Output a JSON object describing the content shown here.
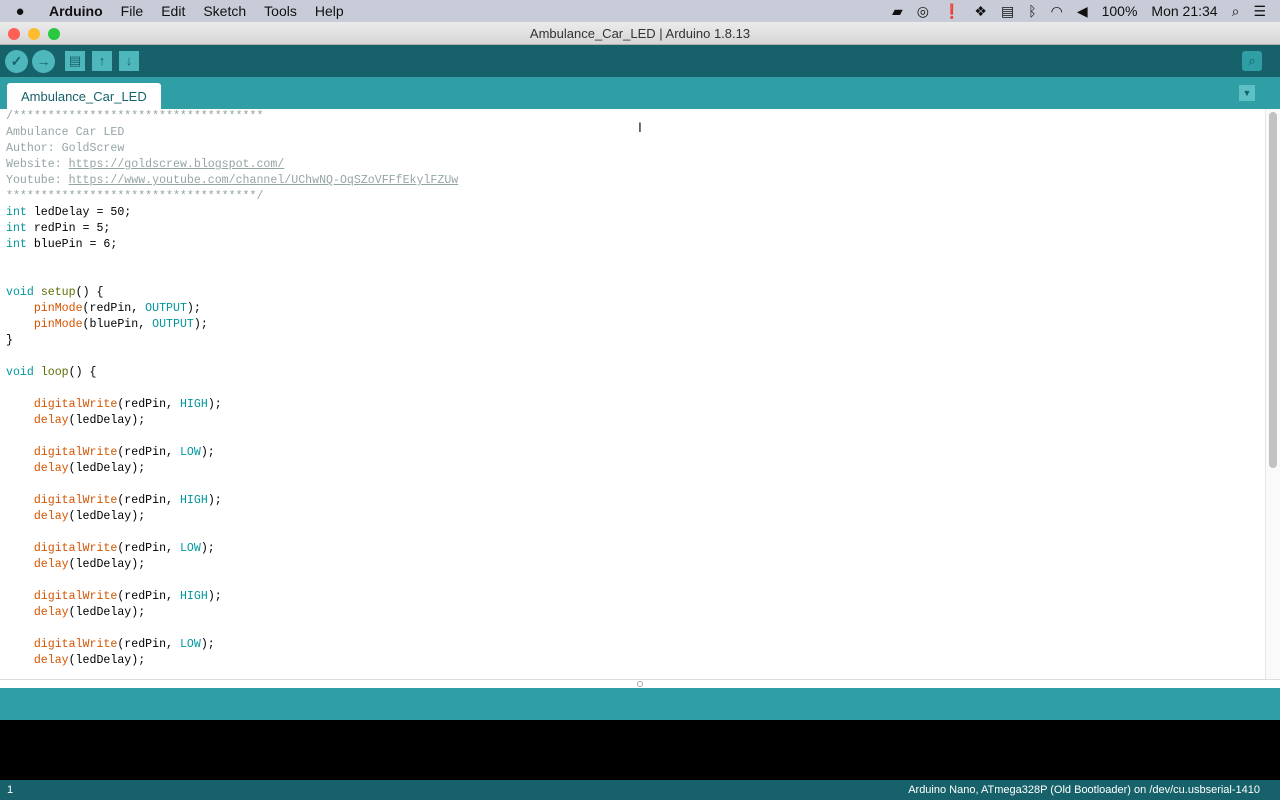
{
  "menubar": {
    "apple": "",
    "app": "Arduino",
    "items": [
      "File",
      "Edit",
      "Sketch",
      "Tools",
      "Help"
    ],
    "battery": "100%",
    "clock": "Mon 21:34"
  },
  "window": {
    "title": "Ambulance_Car_LED | Arduino 1.8.13"
  },
  "toolbar": {
    "verify": "✓",
    "upload": "→",
    "new": "▤",
    "open": "↑",
    "save": "↓",
    "serial_monitor": "⌕"
  },
  "tabs": [
    {
      "label": "Ambulance_Car_LED"
    }
  ],
  "editor": {
    "lines": [
      [
        [
          "comment",
          "/************************************"
        ]
      ],
      [
        [
          "comment",
          "Ambulance Car LED"
        ]
      ],
      [
        [
          "comment",
          "Author: GoldScrew"
        ]
      ],
      [
        [
          "comment",
          "Website: "
        ],
        [
          "link",
          "https://goldscrew.blogspot.com/"
        ]
      ],
      [
        [
          "comment",
          "Youtube: "
        ],
        [
          "link",
          "https://www.youtube.com/channel/UChwNQ-OqSZoVFFfEkylFZUw"
        ]
      ],
      [
        [
          "comment",
          "************************************/"
        ]
      ],
      [
        [
          "kw",
          "int"
        ],
        [
          "plain",
          " ledDelay = 50;"
        ]
      ],
      [
        [
          "kw",
          "int"
        ],
        [
          "plain",
          " redPin = 5;"
        ]
      ],
      [
        [
          "kw",
          "int"
        ],
        [
          "plain",
          " bluePin = 6;"
        ]
      ],
      [],
      [],
      [
        [
          "kw",
          "void"
        ],
        [
          "plain",
          " "
        ],
        [
          "def",
          "setup"
        ],
        [
          "plain",
          "() {"
        ]
      ],
      [
        [
          "plain",
          "    "
        ],
        [
          "fn",
          "pinMode"
        ],
        [
          "plain",
          "(redPin, "
        ],
        [
          "const",
          "OUTPUT"
        ],
        [
          "plain",
          ");"
        ]
      ],
      [
        [
          "plain",
          "    "
        ],
        [
          "fn",
          "pinMode"
        ],
        [
          "plain",
          "(bluePin, "
        ],
        [
          "const",
          "OUTPUT"
        ],
        [
          "plain",
          ");"
        ]
      ],
      [
        [
          "plain",
          "}"
        ]
      ],
      [],
      [
        [
          "kw",
          "void"
        ],
        [
          "plain",
          " "
        ],
        [
          "def",
          "loop"
        ],
        [
          "plain",
          "() {"
        ]
      ],
      [],
      [
        [
          "plain",
          "    "
        ],
        [
          "fn",
          "digitalWrite"
        ],
        [
          "plain",
          "(redPin, "
        ],
        [
          "const",
          "HIGH"
        ],
        [
          "plain",
          ");"
        ]
      ],
      [
        [
          "plain",
          "    "
        ],
        [
          "fn",
          "delay"
        ],
        [
          "plain",
          "(ledDelay);"
        ]
      ],
      [],
      [
        [
          "plain",
          "    "
        ],
        [
          "fn",
          "digitalWrite"
        ],
        [
          "plain",
          "(redPin, "
        ],
        [
          "const",
          "LOW"
        ],
        [
          "plain",
          ");"
        ]
      ],
      [
        [
          "plain",
          "    "
        ],
        [
          "fn",
          "delay"
        ],
        [
          "plain",
          "(ledDelay);"
        ]
      ],
      [],
      [
        [
          "plain",
          "    "
        ],
        [
          "fn",
          "digitalWrite"
        ],
        [
          "plain",
          "(redPin, "
        ],
        [
          "const",
          "HIGH"
        ],
        [
          "plain",
          ");"
        ]
      ],
      [
        [
          "plain",
          "    "
        ],
        [
          "fn",
          "delay"
        ],
        [
          "plain",
          "(ledDelay);"
        ]
      ],
      [],
      [
        [
          "plain",
          "    "
        ],
        [
          "fn",
          "digitalWrite"
        ],
        [
          "plain",
          "(redPin, "
        ],
        [
          "const",
          "LOW"
        ],
        [
          "plain",
          ");"
        ]
      ],
      [
        [
          "plain",
          "    "
        ],
        [
          "fn",
          "delay"
        ],
        [
          "plain",
          "(ledDelay);"
        ]
      ],
      [],
      [
        [
          "plain",
          "    "
        ],
        [
          "fn",
          "digitalWrite"
        ],
        [
          "plain",
          "(redPin, "
        ],
        [
          "const",
          "HIGH"
        ],
        [
          "plain",
          ");"
        ]
      ],
      [
        [
          "plain",
          "    "
        ],
        [
          "fn",
          "delay"
        ],
        [
          "plain",
          "(ledDelay);"
        ]
      ],
      [],
      [
        [
          "plain",
          "    "
        ],
        [
          "fn",
          "digitalWrite"
        ],
        [
          "plain",
          "(redPin, "
        ],
        [
          "const",
          "LOW"
        ],
        [
          "plain",
          ");"
        ]
      ],
      [
        [
          "plain",
          "    "
        ],
        [
          "fn",
          "delay"
        ],
        [
          "plain",
          "(ledDelay);"
        ]
      ]
    ]
  },
  "status": {
    "line": "1",
    "board": "Arduino Nano, ATmega328P (Old Bootloader) on /dev/cu.usbserial-1410"
  },
  "colors": {
    "toolbar": "#17626a",
    "tabbar": "#2f9fa5",
    "keyword": "#00979c",
    "function": "#d35400",
    "comment": "#95a5a6"
  }
}
